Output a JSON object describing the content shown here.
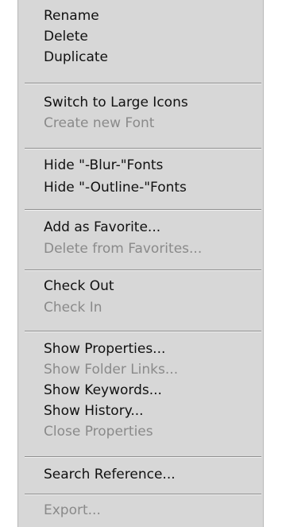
{
  "menu": {
    "items": [
      {
        "label": "Rename",
        "enabled": true
      },
      {
        "label": "Delete",
        "enabled": true
      },
      {
        "label": "Duplicate",
        "enabled": true
      },
      {
        "label": "Switch to Large Icons",
        "enabled": true
      },
      {
        "label": "Create new Font",
        "enabled": false
      },
      {
        "label": "Hide \"-Blur-\"Fonts",
        "enabled": true
      },
      {
        "label": "Hide \"-Outline-\"Fonts",
        "enabled": true
      },
      {
        "label": "Add as Favorite...",
        "enabled": true
      },
      {
        "label": "Delete from Favorites...",
        "enabled": false
      },
      {
        "label": "Check Out",
        "enabled": true
      },
      {
        "label": "Check In",
        "enabled": false
      },
      {
        "label": "Show Properties...",
        "enabled": true
      },
      {
        "label": "Show Folder Links...",
        "enabled": false
      },
      {
        "label": "Show Keywords...",
        "enabled": true
      },
      {
        "label": "Show History...",
        "enabled": true
      },
      {
        "label": "Close Properties",
        "enabled": false
      },
      {
        "label": "Search Reference...",
        "enabled": true
      },
      {
        "label": "Export...",
        "enabled": false
      }
    ]
  },
  "colors": {
    "menu_background": "#d7d7d7",
    "enabled_text": "#111111",
    "disabled_text": "#8a8a8a",
    "separator_dark": "#8f8f8f",
    "separator_light": "#f2f2f2"
  }
}
